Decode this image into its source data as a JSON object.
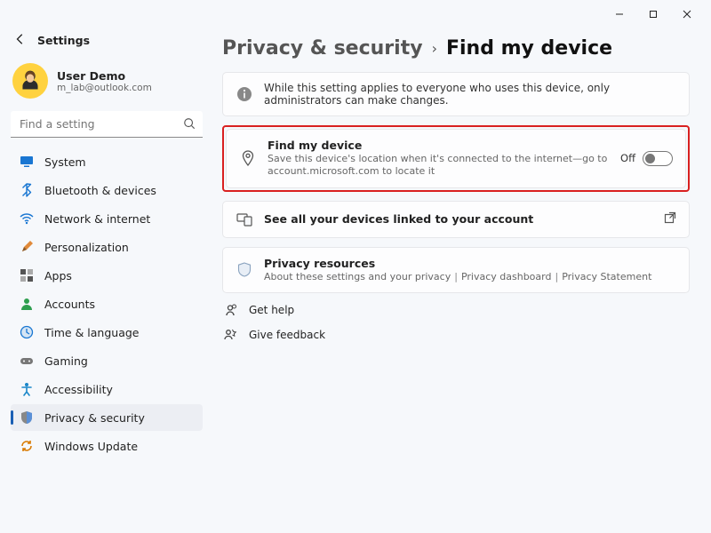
{
  "app_title": "Settings",
  "window_controls": {
    "minimize": "–",
    "maximize": "□",
    "close": "✕"
  },
  "profile": {
    "name": "User Demo",
    "email": "m_lab@outlook.com"
  },
  "search": {
    "placeholder": "Find a setting"
  },
  "sidebar": {
    "items": [
      {
        "label": "System",
        "icon": "system"
      },
      {
        "label": "Bluetooth & devices",
        "icon": "bluetooth"
      },
      {
        "label": "Network & internet",
        "icon": "wifi"
      },
      {
        "label": "Personalization",
        "icon": "brush"
      },
      {
        "label": "Apps",
        "icon": "apps"
      },
      {
        "label": "Accounts",
        "icon": "account"
      },
      {
        "label": "Time & language",
        "icon": "time"
      },
      {
        "label": "Gaming",
        "icon": "gaming"
      },
      {
        "label": "Accessibility",
        "icon": "access"
      },
      {
        "label": "Privacy & security",
        "icon": "shield",
        "active": true
      },
      {
        "label": "Windows Update",
        "icon": "update"
      }
    ]
  },
  "breadcrumb": {
    "parent": "Privacy & security",
    "current": "Find my device"
  },
  "info_banner": "While this setting applies to everyone who uses this device, only administrators can make changes.",
  "find_card": {
    "title": "Find my device",
    "sub": "Save this device's location when it's connected to the internet—go to account.microsoft.com to locate it",
    "state": "Off"
  },
  "linked_card": {
    "title": "See all your devices linked to your account"
  },
  "privacy_card": {
    "title": "Privacy resources",
    "sub_parts": [
      "About these settings and your privacy",
      "Privacy dashboard",
      "Privacy Statement"
    ]
  },
  "footer_links": [
    {
      "label": "Get help",
      "icon": "help"
    },
    {
      "label": "Give feedback",
      "icon": "feedback"
    }
  ]
}
